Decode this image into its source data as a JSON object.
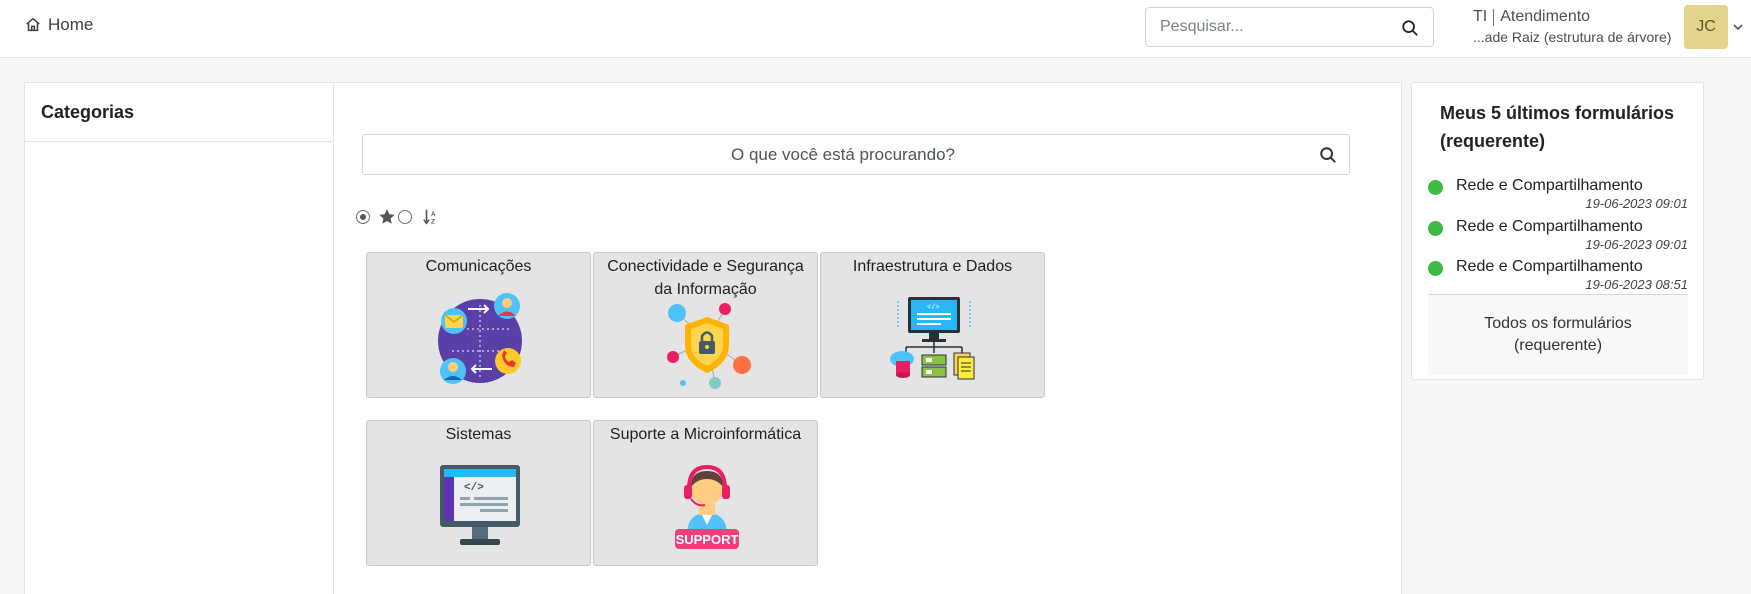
{
  "header": {
    "home_label": "Home",
    "search_placeholder": "Pesquisar...",
    "entity_name": "TI",
    "entity_profile": "Atendimento",
    "entity_path": "...ade Raiz (estrutura de árvore)",
    "avatar_initials": "JC",
    "avatar_color": "#e2d48a"
  },
  "categories": {
    "title": "Categorias"
  },
  "main": {
    "search_placeholder": "O que você está procurando?",
    "tiles": [
      {
        "label": "Comunicações",
        "icon": "communication-icon"
      },
      {
        "label": "Conectividade e Segurança da Informação",
        "icon": "security-shield-icon"
      },
      {
        "label": "Infraestrutura e Dados",
        "icon": "infrastructure-icon"
      },
      {
        "label": "Sistemas",
        "icon": "systems-monitor-icon"
      },
      {
        "label": "Suporte a Microinformática",
        "icon": "support-agent-icon"
      }
    ]
  },
  "recent": {
    "title": "Meus 5 últimos formulários (requerente)",
    "status_color": "#3ebb46",
    "items": [
      {
        "name": "Rede e Compartilhamento",
        "date": "19-06-2023 09:01"
      },
      {
        "name": "Rede e Compartilhamento",
        "date": "19-06-2023 09:01"
      },
      {
        "name": "Rede e Compartilhamento",
        "date": "19-06-2023 08:51"
      }
    ],
    "all_forms_label": "Todos os formulários (requerente)"
  }
}
